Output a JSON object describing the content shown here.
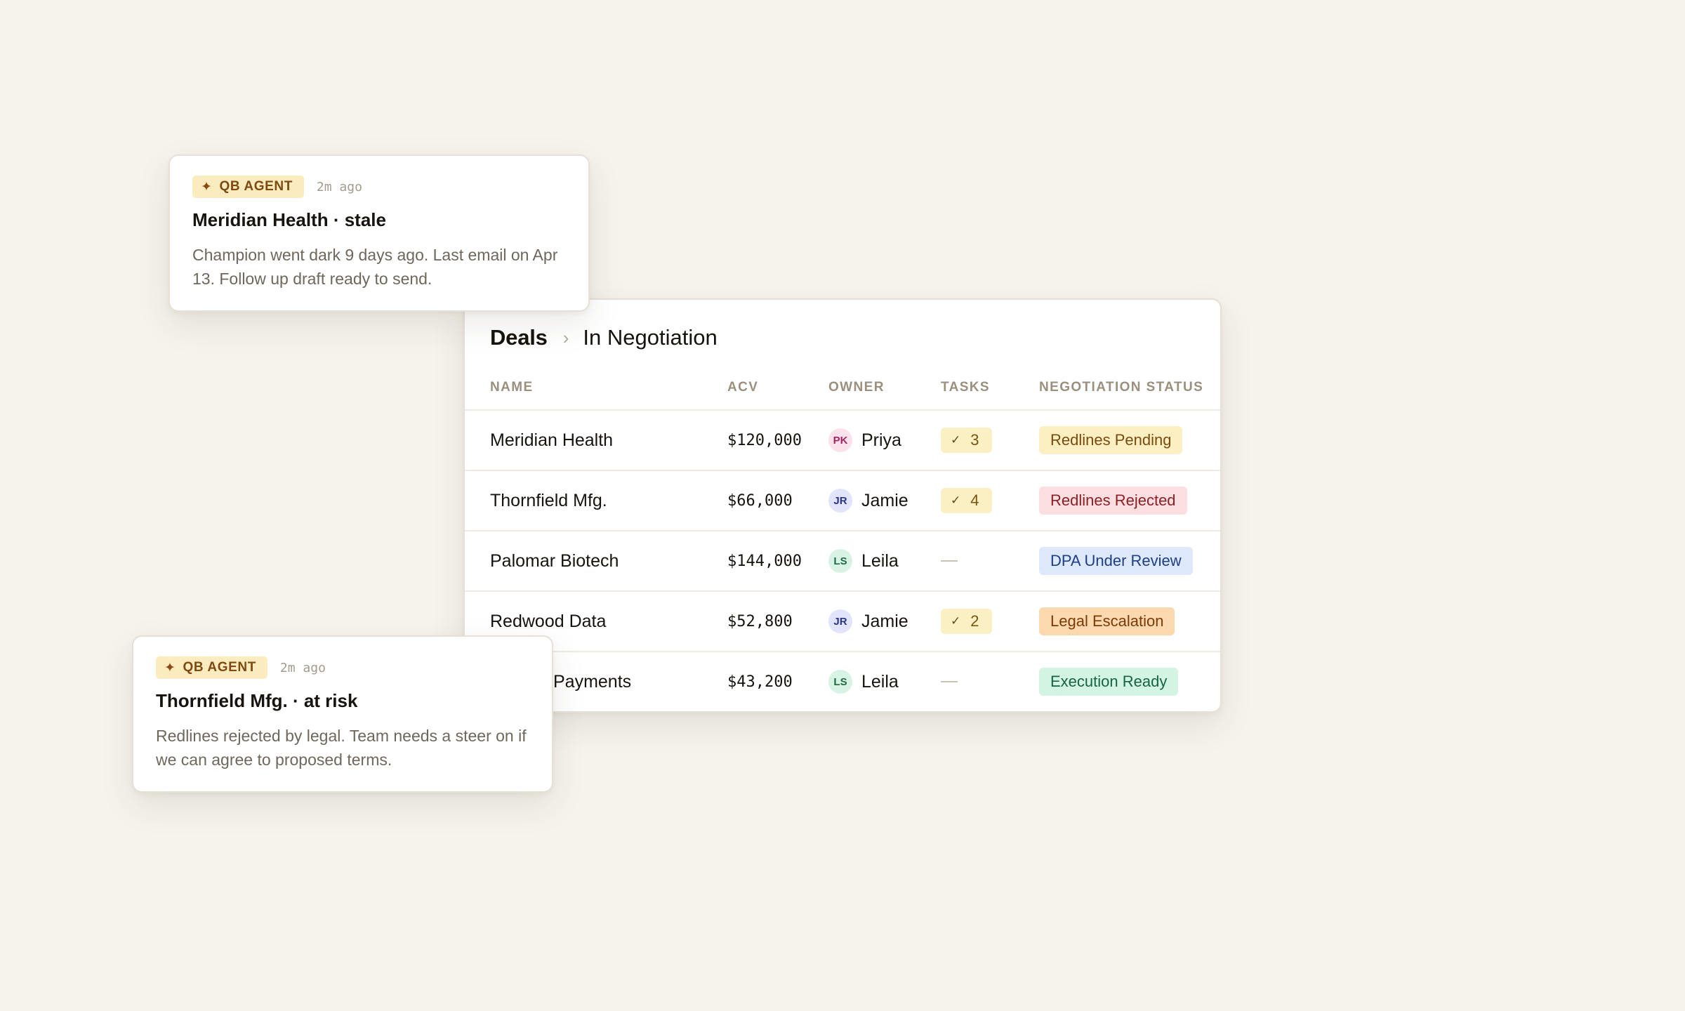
{
  "deals": {
    "breadcrumb": {
      "root": "Deals",
      "separator": "›",
      "current": "In Negotiation"
    },
    "columns": {
      "name": "NAME",
      "acv": "ACV",
      "owner": "OWNER",
      "tasks": "TASKS",
      "status": "NEGOTIATION STATUS"
    },
    "rows": [
      {
        "name": "Meridian Health",
        "acv": "$120,000",
        "owner_initials": "PK",
        "owner": "Priya",
        "tasks": "3",
        "status": "Redlines Pending"
      },
      {
        "name": "Thornfield Mfg.",
        "acv": "$66,000",
        "owner_initials": "JR",
        "owner": "Jamie",
        "tasks": "4",
        "status": "Redlines Rejected"
      },
      {
        "name": "Palomar Biotech",
        "acv": "$144,000",
        "owner_initials": "LS",
        "owner": "Leila",
        "tasks": "",
        "status": "DPA Under Review"
      },
      {
        "name": "Redwood Data",
        "acv": "$52,800",
        "owner_initials": "JR",
        "owner": "Jamie",
        "tasks": "2",
        "status": "Legal Escalation"
      },
      {
        "name": "Payments",
        "acv": "$43,200",
        "owner_initials": "LS",
        "owner": "Leila",
        "tasks": "",
        "status": "Execution Ready"
      }
    ]
  },
  "agent_cards": [
    {
      "badge": "QB AGENT",
      "time": "2m ago",
      "title": "Meridian Health · stale",
      "body": "Champion went dark 9 days ago. Last email on Apr 13. Follow up draft ready to send."
    },
    {
      "badge": "QB AGENT",
      "time": "2m ago",
      "title": "Thornfield Mfg. · at risk",
      "body": "Redlines rejected by legal. Team needs a steer on if we can agree to proposed terms."
    }
  ],
  "icons": {
    "task_check": "check-icon",
    "agent_badge": "sparkle-icon"
  },
  "colors": {
    "background": "#f6f3ec",
    "avatar_pk": "#fbe1ec",
    "avatar_pk_text": "#a3245f",
    "avatar_jr": "#e1e4fb",
    "avatar_jr_text": "#2c3486",
    "avatar_ls": "#d8f3e4",
    "avatar_ls_text": "#1f6b44",
    "status_pending": "#fcefc2",
    "status_pending_text": "#7a4a0e",
    "status_rejected": "#fbdfe0",
    "status_rejected_text": "#8d1f26",
    "status_review": "#dde8fb",
    "status_review_text": "#1d3f8a",
    "status_escalation": "#fbd8ae",
    "status_escalation_text": "#7a3b08",
    "status_ready": "#d3f4e2",
    "status_ready_text": "#176440",
    "task_pill": "#fbefc4",
    "agent_badge_bg": "#fbecbf"
  }
}
